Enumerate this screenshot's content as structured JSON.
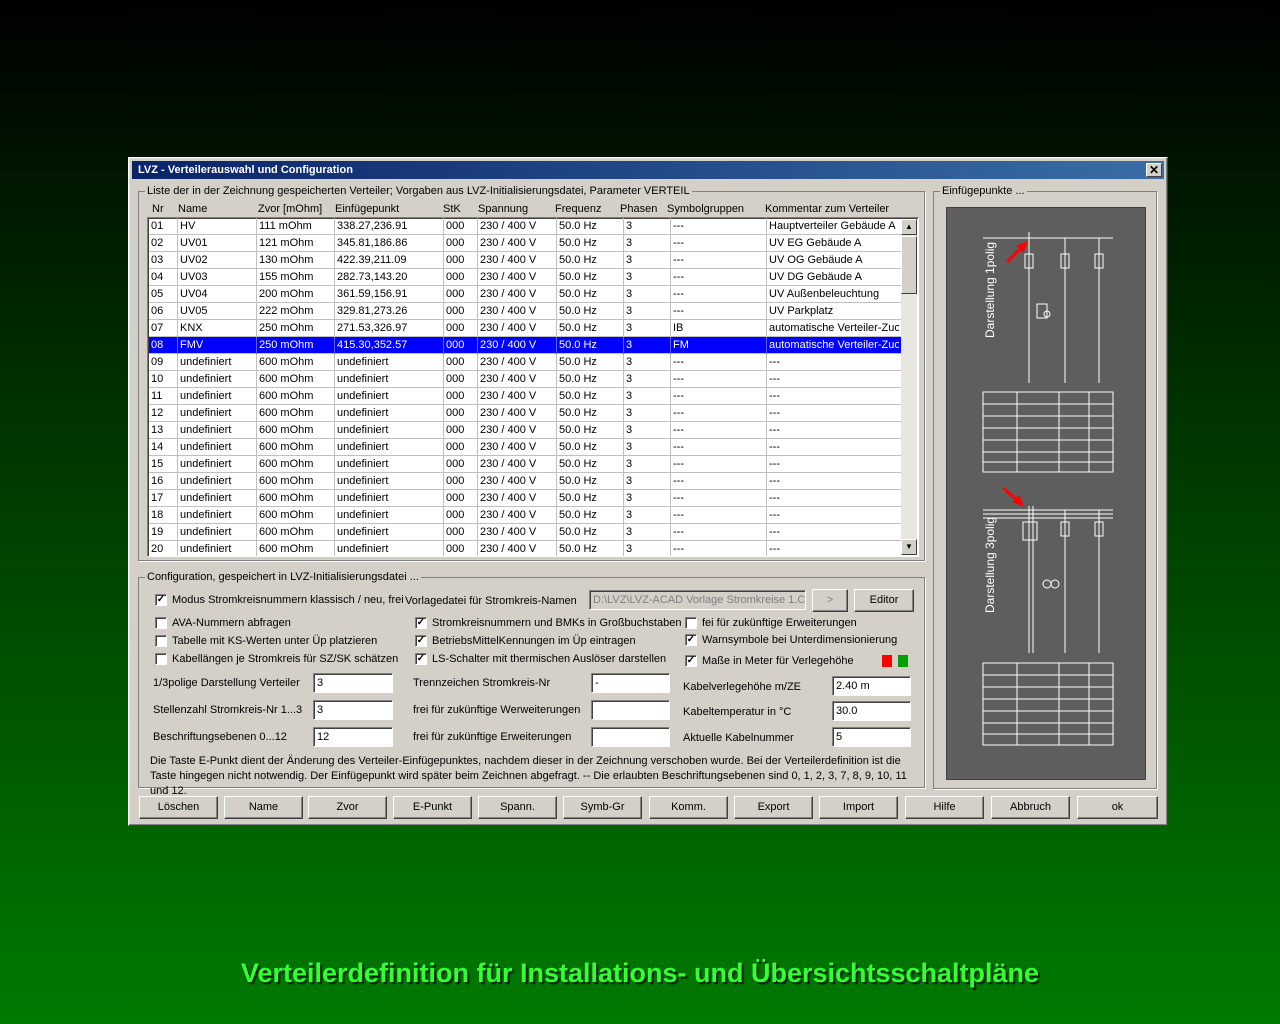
{
  "window": {
    "title": "LVZ - Verteilerauswahl und Configuration",
    "close_glyph": "✕"
  },
  "list_group": {
    "label": "Liste der in der Zeichnung gespeicherten Verteiler; Vorgaben aus LVZ-Initialisierungsdatei, Parameter VERTEIL"
  },
  "columns": [
    "Nr",
    "Name",
    "Zvor [mOhm]",
    "Einfügepunkt",
    "StK",
    "Spannung",
    "Frequenz",
    "Phasen",
    "Symbolgruppen",
    "Kommentar zum Verteiler"
  ],
  "rows": [
    [
      "01",
      "HV",
      "111 mOhm",
      "338.27,236.91",
      "000",
      "230 / 400 V",
      "50.0 Hz",
      "3",
      "---",
      "Hauptverteiler Gebäude A"
    ],
    [
      "02",
      "UV01",
      "121 mOhm",
      "345.81,186.86",
      "000",
      "230 / 400 V",
      "50.0 Hz",
      "3",
      "---",
      "UV EG Gebäude A"
    ],
    [
      "03",
      "UV02",
      "130 mOhm",
      "422.39,211.09",
      "000",
      "230 / 400 V",
      "50.0 Hz",
      "3",
      "---",
      "UV OG Gebäude A"
    ],
    [
      "04",
      "UV03",
      "155 mOhm",
      "282.73,143.20",
      "000",
      "230 / 400 V",
      "50.0 Hz",
      "3",
      "---",
      "UV DG Gebäude A"
    ],
    [
      "05",
      "UV04",
      "200 mOhm",
      "361.59,156.91",
      "000",
      "230 / 400 V",
      "50.0 Hz",
      "3",
      "---",
      "UV Außenbeleuchtung"
    ],
    [
      "06",
      "UV05",
      "222 mOhm",
      "329.81,273.26",
      "000",
      "230 / 400 V",
      "50.0 Hz",
      "3",
      "---",
      "UV Parkplatz"
    ],
    [
      "07",
      "KNX",
      "250 mOhm",
      "271.53,326.97",
      "000",
      "230 / 400 V",
      "50.0 Hz",
      "3",
      "IB",
      "automatische Verteiler-Zuo"
    ],
    [
      "08",
      "FMV",
      "250 mOhm",
      "415.30,352.57",
      "000",
      "230 / 400 V",
      "50.0 Hz",
      "3",
      "FM",
      "automatische Verteiler-Zuo"
    ],
    [
      "09",
      "undefiniert",
      "600 mOhm",
      "undefiniert",
      "000",
      "230 / 400 V",
      "50.0 Hz",
      "3",
      "---",
      "---"
    ],
    [
      "10",
      "undefiniert",
      "600 mOhm",
      "undefiniert",
      "000",
      "230 / 400 V",
      "50.0 Hz",
      "3",
      "---",
      "---"
    ],
    [
      "11",
      "undefiniert",
      "600 mOhm",
      "undefiniert",
      "000",
      "230 / 400 V",
      "50.0 Hz",
      "3",
      "---",
      "---"
    ],
    [
      "12",
      "undefiniert",
      "600 mOhm",
      "undefiniert",
      "000",
      "230 / 400 V",
      "50.0 Hz",
      "3",
      "---",
      "---"
    ],
    [
      "13",
      "undefiniert",
      "600 mOhm",
      "undefiniert",
      "000",
      "230 / 400 V",
      "50.0 Hz",
      "3",
      "---",
      "---"
    ],
    [
      "14",
      "undefiniert",
      "600 mOhm",
      "undefiniert",
      "000",
      "230 / 400 V",
      "50.0 Hz",
      "3",
      "---",
      "---"
    ],
    [
      "15",
      "undefiniert",
      "600 mOhm",
      "undefiniert",
      "000",
      "230 / 400 V",
      "50.0 Hz",
      "3",
      "---",
      "---"
    ],
    [
      "16",
      "undefiniert",
      "600 mOhm",
      "undefiniert",
      "000",
      "230 / 400 V",
      "50.0 Hz",
      "3",
      "---",
      "---"
    ],
    [
      "17",
      "undefiniert",
      "600 mOhm",
      "undefiniert",
      "000",
      "230 / 400 V",
      "50.0 Hz",
      "3",
      "---",
      "---"
    ],
    [
      "18",
      "undefiniert",
      "600 mOhm",
      "undefiniert",
      "000",
      "230 / 400 V",
      "50.0 Hz",
      "3",
      "---",
      "---"
    ],
    [
      "19",
      "undefiniert",
      "600 mOhm",
      "undefiniert",
      "000",
      "230 / 400 V",
      "50.0 Hz",
      "3",
      "---",
      "---"
    ],
    [
      "20",
      "undefiniert",
      "600 mOhm",
      "undefiniert",
      "000",
      "230 / 400 V",
      "50.0 Hz",
      "3",
      "---",
      "---"
    ]
  ],
  "selected_row": "08",
  "config_group": {
    "label": "Configuration, gespeichert in LVZ-Initialisierungsdatei ..."
  },
  "checkboxes": {
    "modus": {
      "label": "Modus Stromkreisnummern klassisch / neu, frei",
      "checked": true
    },
    "ava": {
      "label": "AVA-Nummern abfragen",
      "checked": false
    },
    "tabelle": {
      "label": "Tabelle mit KS-Werten unter Üp platzieren",
      "checked": false
    },
    "kabellaengen": {
      "label": "Kabellängen je Stromkreis für SZ/SK schätzen",
      "checked": false
    },
    "gross": {
      "label": "Stromkreisnummern und BMKs in Großbuchstaben",
      "checked": true
    },
    "bmk": {
      "label": "BetriebsMittelKennungen im Üp eintragen",
      "checked": true
    },
    "ls": {
      "label": "LS-Schalter mit thermischen Auslöser darstellen",
      "checked": true
    },
    "fei": {
      "label": "fei für zukünftige Erweiterungen",
      "checked": false
    },
    "warn": {
      "label": "Warnsymbole bei Unterdimensionierung",
      "checked": true
    },
    "masse": {
      "label": "Maße in Meter für Verlegehöhe",
      "checked": true
    }
  },
  "check_glyph": "✓",
  "vorlage": {
    "label": "Vorlagedatei für Stromkreis-Namen",
    "value": "D:\\LVZ\\LVZ-ACAD Vorlage Stromkreise 1.CSV",
    "browse": ">",
    "editor": "Editor"
  },
  "fields": {
    "darstellung": {
      "label": "1/3polige Darstellung Verteiler",
      "value": "3"
    },
    "stellenzahl": {
      "label": "Stellenzahl Stromkreis-Nr 1...3",
      "value": "3"
    },
    "beschriftung": {
      "label": "Beschriftungsebenen 0...12",
      "value": "12"
    },
    "trennzeichen": {
      "label": "Trennzeichen Stromkreis-Nr",
      "value": "-"
    },
    "frei1": {
      "label": "frei für zukünftige Werweiterungen",
      "value": ""
    },
    "frei2": {
      "label": "frei für zukünftige Erweiterungen",
      "value": ""
    },
    "verlegehoehe": {
      "label": "Kabelverlegehöhe m/ZE",
      "value": "2.40 m"
    },
    "kabeltemp": {
      "label": "Kabeltemperatur in °C",
      "value": "30.0"
    },
    "kabelnr": {
      "label": "Aktuelle Kabelnummer",
      "value": "5"
    }
  },
  "info_text": "Die Taste E-Punkt dient der Änderung des Verteiler-Einfügepunktes, nachdem dieser in der Zeichnung verschoben wurde. Bei der Verteilerdefinition ist die Taste hingegen nicht notwendig. Der Einfügepunkt wird später beim Zeichnen abgefragt. -- Die erlaubten Beschriftungsebenen sind 0, 1, 2, 3, 7, 8, 9, 10, 11 und 12.",
  "preview_group": {
    "label": "Einfügepunkte ...",
    "text_1pol": "Darstellung 1polig",
    "text_3pol": "Darstellung 3polig"
  },
  "buttons": [
    "Löschen",
    "Name",
    "Zvor",
    "E-Punkt",
    "Spann.",
    "Symb-Gr",
    "Komm.",
    "Export",
    "Import",
    "Hilfe",
    "Abbruch",
    "ok"
  ],
  "caption": "Verteilerdefinition für Installations- und Übersichtsschaltpläne",
  "colors": {
    "selection": "#0000ff",
    "caption": "#33ff33",
    "indicator_red": "#ff0000",
    "indicator_green": "#00a000"
  }
}
